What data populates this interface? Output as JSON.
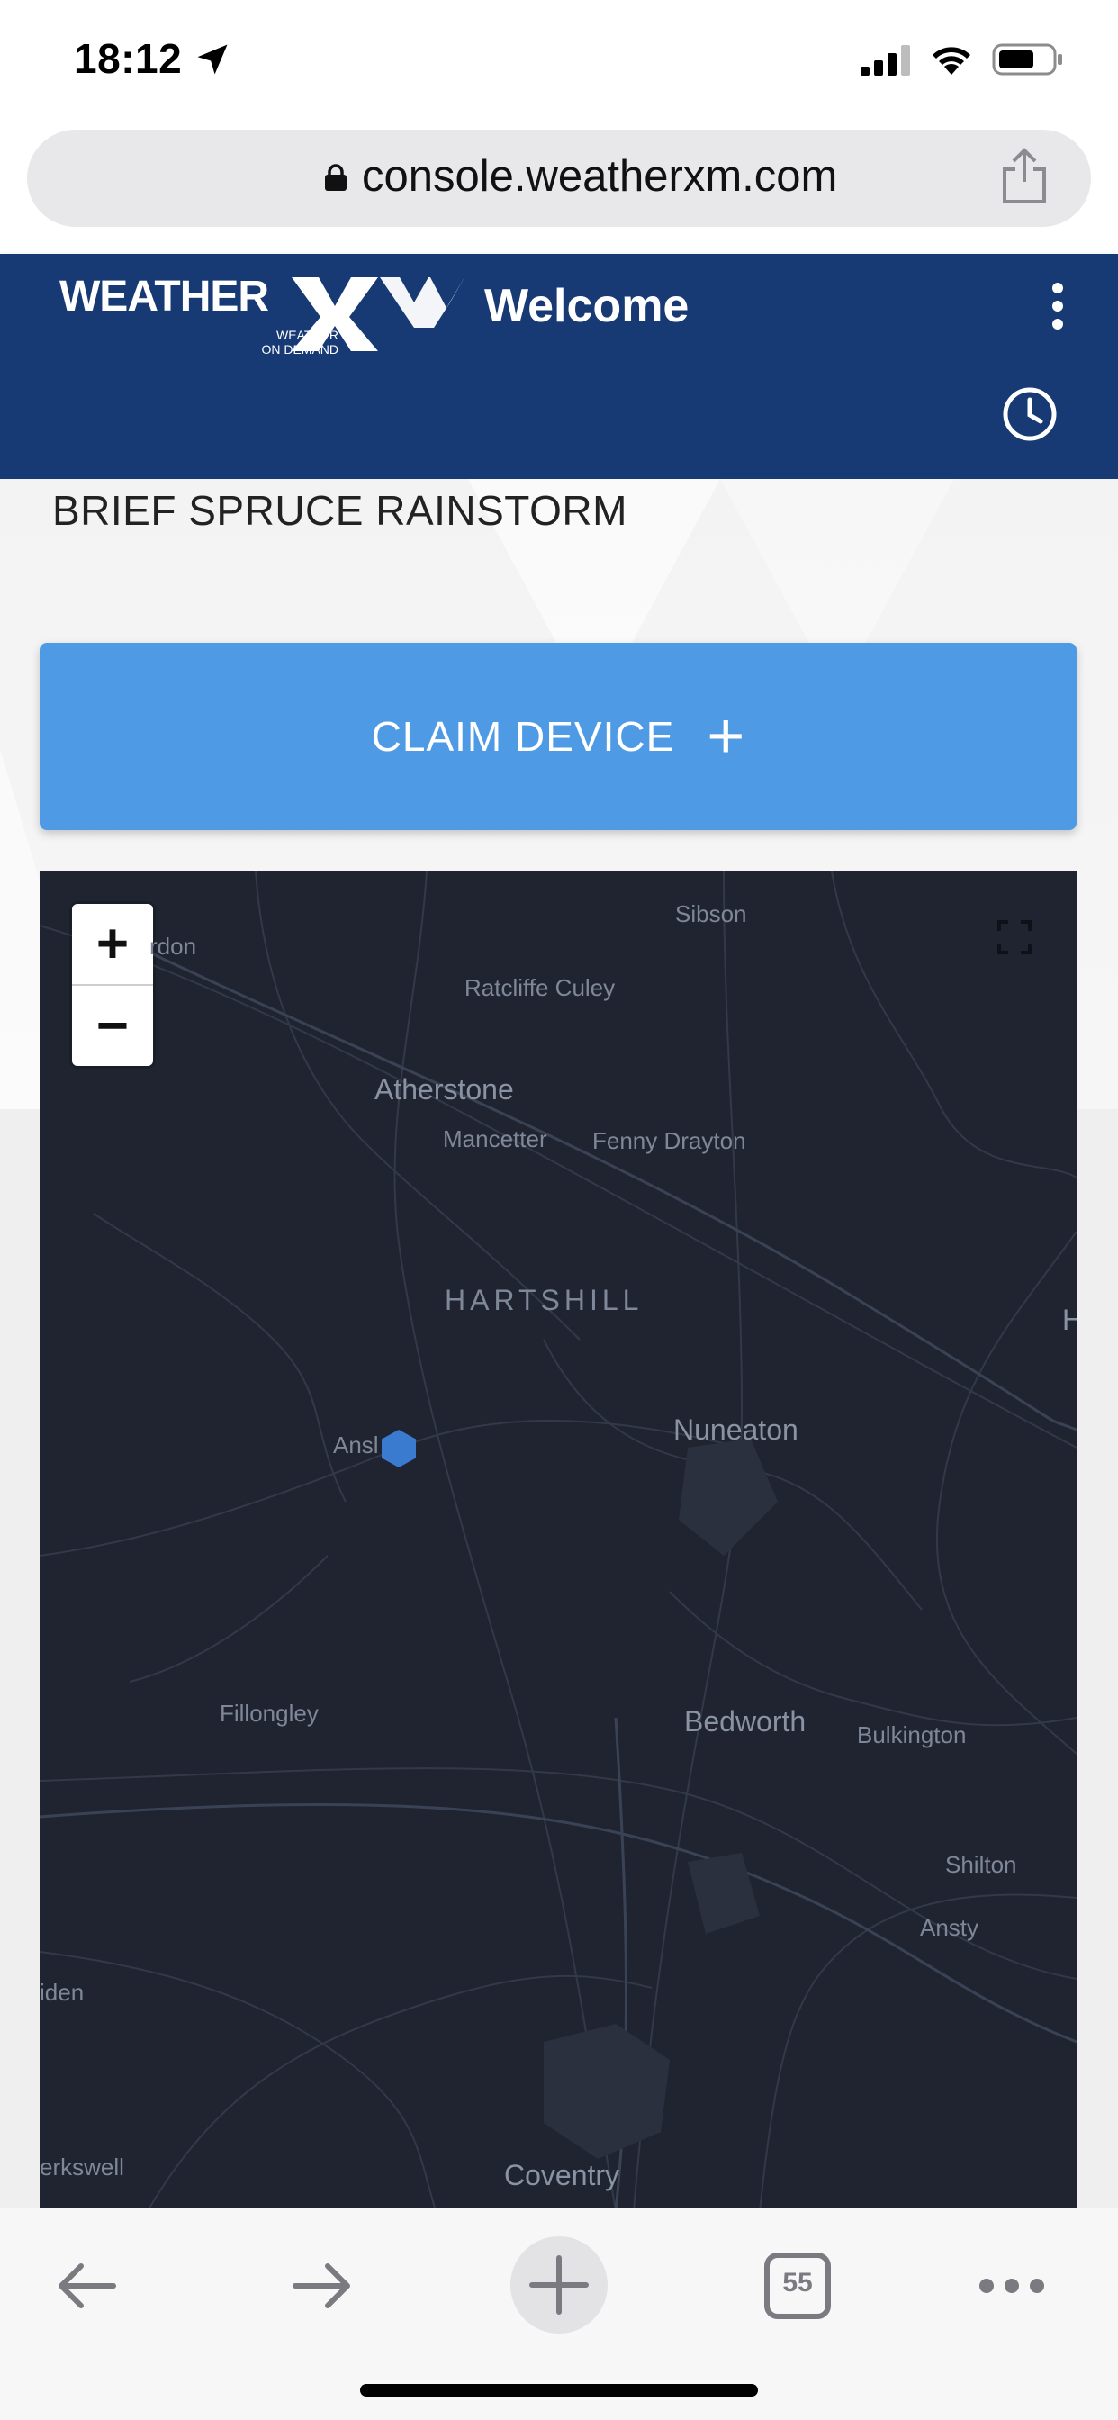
{
  "status": {
    "time": "18:12"
  },
  "browser": {
    "url": "console.weatherxm.com",
    "tab_count": "55"
  },
  "header": {
    "logo_word": "WEATHER",
    "logo_sub_line1": "WEATHER",
    "logo_sub_line2": "ON DEMAND",
    "title": "Welcome"
  },
  "device": {
    "name": "BRIEF SPRUCE RAINSTORM"
  },
  "claim_button": {
    "label": "CLAIM DEVICE",
    "plus": "+"
  },
  "map": {
    "zoom_in": "+",
    "zoom_out": "−",
    "station_color": "#3a7bd0",
    "places": {
      "rdon": "rdon",
      "sibson": "Sibson",
      "ratcliffe": "Ratcliffe Culey",
      "atherstone": "Atherstone",
      "mancetter": "Mancetter",
      "fenny": "Fenny Drayton",
      "hartshill": "HARTSHILL",
      "nuneaton": "Nuneaton",
      "ansl": "Ansl",
      "fillongley": "Fillongley",
      "bedworth": "Bedworth",
      "bulkington": "Bulkington",
      "shilton": "Shilton",
      "ansty": "Ansty",
      "iden": "iden",
      "erkswell": "erkswell",
      "coventry": "Coventry",
      "h_edge": "H"
    }
  },
  "colors": {
    "header_bg": "#173a75",
    "claim_bg": "#4f9ae4",
    "map_bg": "#1f2430"
  }
}
